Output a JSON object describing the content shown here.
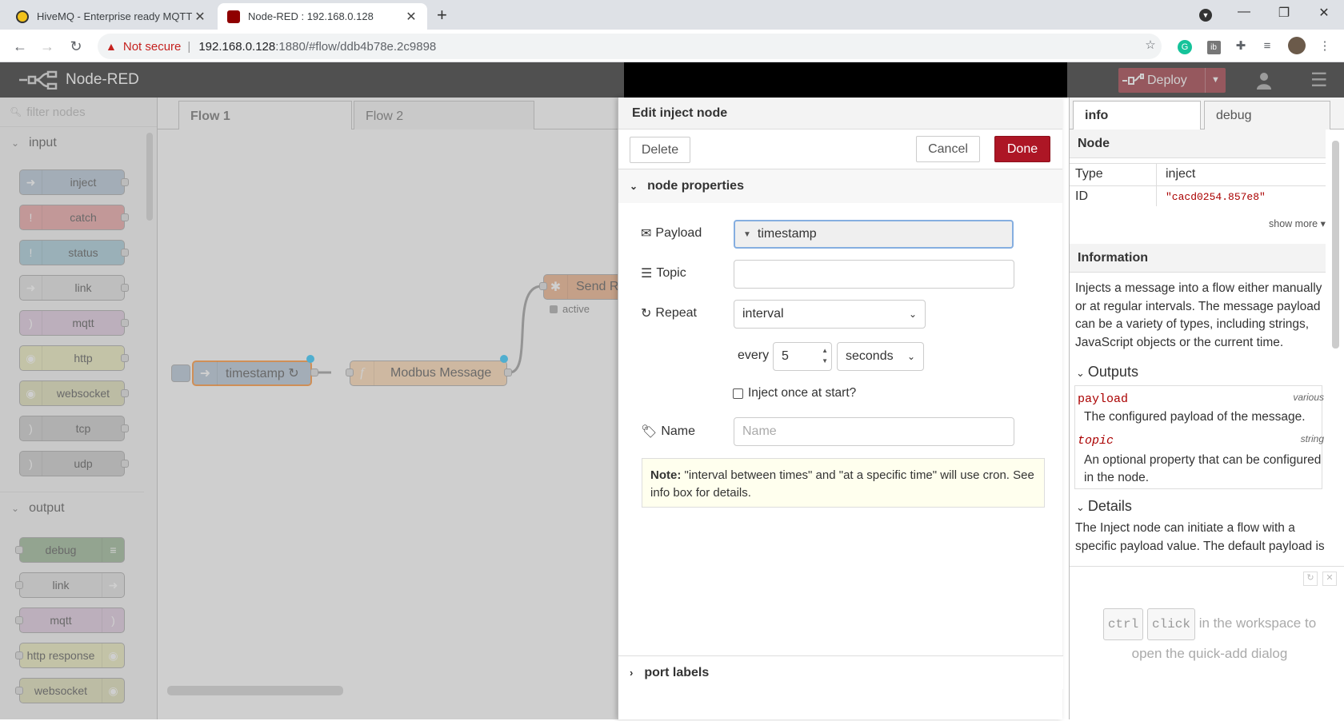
{
  "browser": {
    "tabs": [
      {
        "title": "HiveMQ - Enterprise ready MQTT",
        "active": false
      },
      {
        "title": "Node-RED : 192.168.0.128",
        "active": true
      }
    ],
    "new_tab": "+",
    "url": {
      "security": "Not secure",
      "host": "192.168.0.128",
      "path": ":1880/#flow/ddb4b78e.2c9898"
    }
  },
  "app": {
    "title": "Node-RED",
    "deploy_label": "Deploy"
  },
  "palette": {
    "filter_placeholder": "filter nodes",
    "categories": [
      {
        "name": "input",
        "nodes": [
          "inject",
          "catch",
          "status",
          "link",
          "mqtt",
          "http",
          "websocket",
          "tcp",
          "udp"
        ]
      },
      {
        "name": "output",
        "nodes": [
          "debug",
          "link",
          "mqtt",
          "http response",
          "websocket"
        ]
      }
    ]
  },
  "workspace": {
    "tabs": [
      "Flow 1",
      "Flow 2"
    ],
    "nodes": {
      "inject": "timestamp ↻",
      "function": "Modbus Message",
      "send": "Send R",
      "send_status": "active"
    }
  },
  "editor": {
    "title": "Edit inject node",
    "delete": "Delete",
    "cancel": "Cancel",
    "done": "Done",
    "section": "node properties",
    "payload_label": "Payload",
    "payload_value": "timestamp",
    "topic_label": "Topic",
    "topic_value": "",
    "repeat_label": "Repeat",
    "repeat_value": "interval",
    "every_label": "every",
    "every_value": "5",
    "units_value": "seconds",
    "inject_once_label": "Inject once at start?",
    "inject_once_checked": false,
    "name_label": "Name",
    "name_placeholder": "Name",
    "note_bold": "Note:",
    "note_text": " \"interval between times\" and \"at a specific time\" will use cron. See info box for details.",
    "port_labels": "port labels"
  },
  "sidebar": {
    "tabs": [
      "info",
      "debug"
    ],
    "node_header": "Node",
    "type_label": "Type",
    "type_value": "inject",
    "id_label": "ID",
    "id_value": "\"cacd0254.857e8\"",
    "show_more": "show more ▾",
    "information_header": "Information",
    "info_text": "Injects a message into a flow either manually or at regular intervals. The message payload can be a variety of types, including strings, JavaScript objects or the current time.",
    "outputs_label": "Outputs",
    "outputs": [
      {
        "name": "payload",
        "type": "various",
        "desc": "The configured payload of the message."
      },
      {
        "name": "topic",
        "type": "string",
        "desc": "An optional property that can be configured in the node."
      }
    ],
    "details_label": "Details",
    "details_text": "The Inject node can initiate a flow with a specific payload value. The default payload is a timestamp of the current time in millisecs",
    "help_key1": "ctrl",
    "help_key2": "click",
    "help_text1": " in the workspace to",
    "help_text2": "open the quick-add dialog"
  },
  "colors": {
    "deploy": "#8c101c",
    "done": "#ad1625",
    "inject": "#a6bbcf",
    "catch": "#e49191",
    "status": "#94c1d0",
    "mqtt": "#d8bfd8",
    "http": "#e7e7ae",
    "function": "#fdd0a2",
    "debug": "#87a980"
  }
}
